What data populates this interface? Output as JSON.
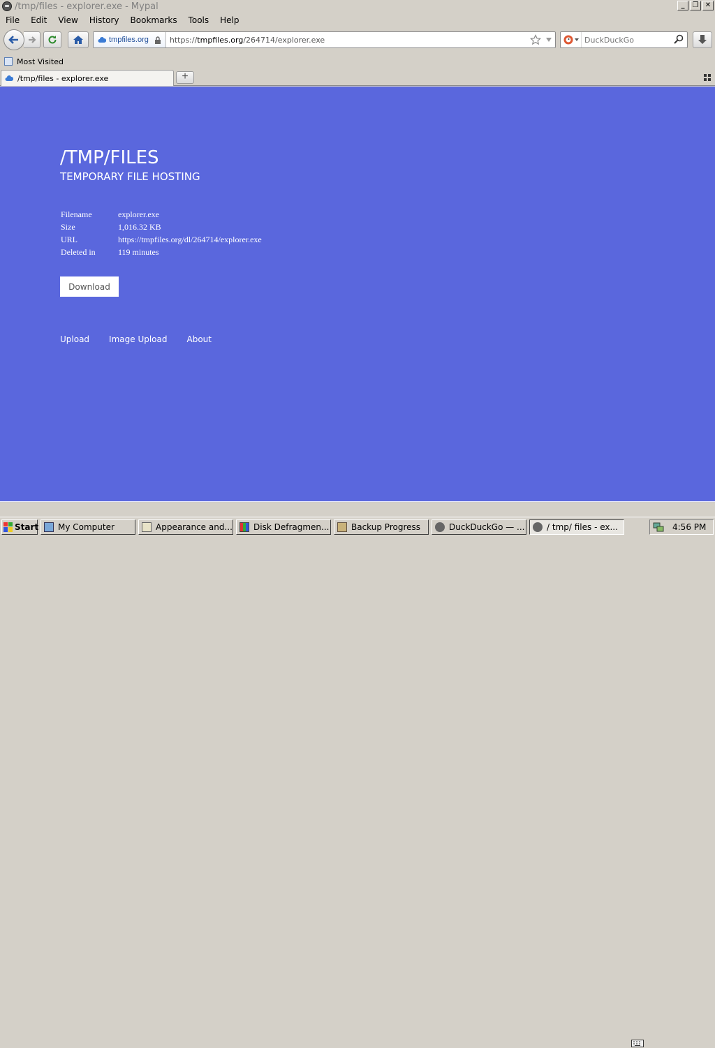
{
  "window": {
    "title": "/tmp/files - explorer.exe - Mypal",
    "controls": [
      "_",
      "❐",
      "✕"
    ]
  },
  "menu": [
    "File",
    "Edit",
    "View",
    "History",
    "Bookmarks",
    "Tools",
    "Help"
  ],
  "navbar": {
    "site_identity": "tmpfiles.org",
    "url_prefix": "https://",
    "url_domain": "tmpfiles.org",
    "url_path": "/264714/explorer.exe",
    "search_placeholder": "DuckDuckGo"
  },
  "bookmarks": {
    "items": [
      "Most Visited"
    ]
  },
  "tabs": {
    "active_label": "/tmp/files - explorer.exe",
    "new_tab": "+"
  },
  "page": {
    "title": "/TMP/FILES",
    "subtitle": "TEMPORARY FILE HOSTING",
    "meta": [
      {
        "key": "Filename",
        "value": "explorer.exe"
      },
      {
        "key": "Size",
        "value": "1,016.32 KB"
      },
      {
        "key": "URL",
        "value": "https://tmpfiles.org/dl/264714/explorer.exe"
      },
      {
        "key": "Deleted in",
        "value": "119 minutes"
      }
    ],
    "download_label": "Download",
    "footer_links": [
      "Upload",
      "Image Upload",
      "About"
    ]
  },
  "taskbar": {
    "start_label": "Start",
    "tasks": [
      {
        "label": "My Computer",
        "icon": "computer-icon"
      },
      {
        "label": "Appearance and...",
        "icon": "control-panel-icon"
      },
      {
        "label": "Disk Defragmen...",
        "icon": "defrag-icon"
      },
      {
        "label": "Backup Progress",
        "icon": "backup-icon"
      },
      {
        "label": "DuckDuckGo — ...",
        "icon": "mypal-icon"
      },
      {
        "label": "/ tmp/ files - ex...",
        "icon": "mypal-icon"
      }
    ],
    "clock": "4:56 PM"
  },
  "colors": {
    "page_bg": "#5a67dd",
    "chrome": "#d4d0c8"
  }
}
